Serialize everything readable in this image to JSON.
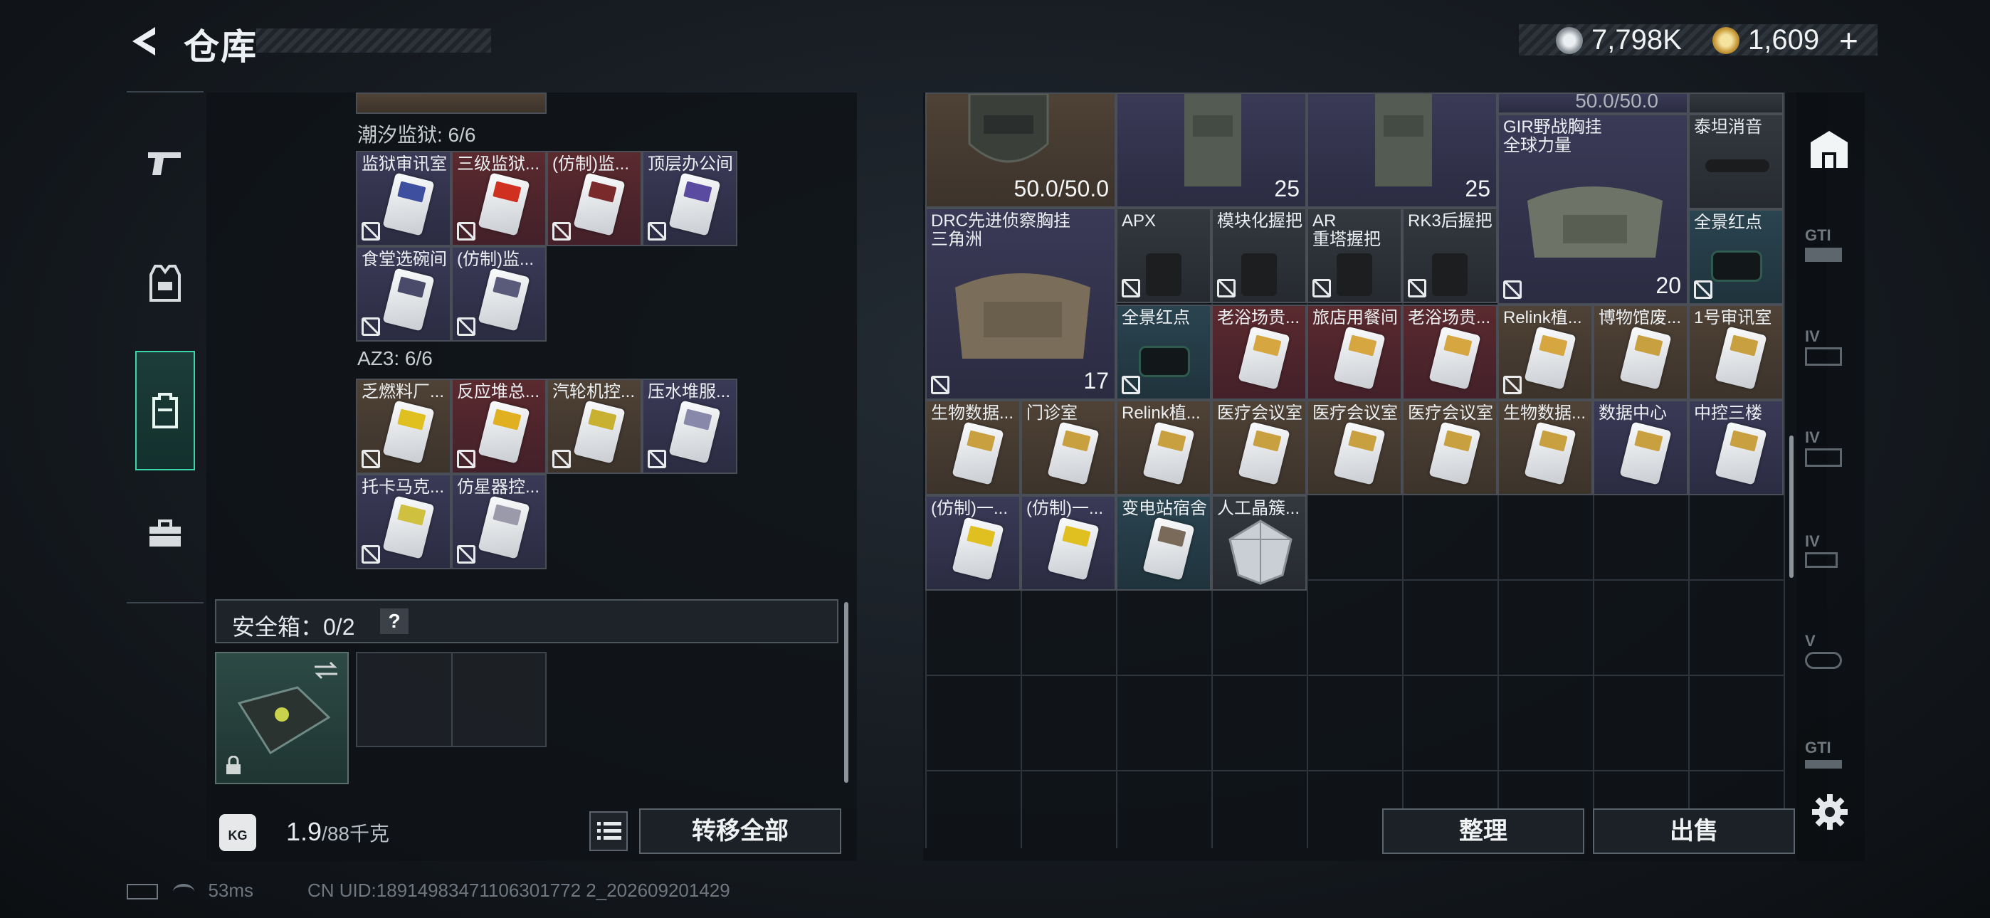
{
  "header": {
    "title": "仓库",
    "currency": [
      {
        "icon": "silver-coin-icon",
        "value": "7,798K"
      },
      {
        "icon": "gold-coin-icon",
        "value": "1,609"
      }
    ],
    "add_label": "+"
  },
  "left_nav": [
    {
      "icon": "pistol-icon"
    },
    {
      "icon": "vest-icon"
    },
    {
      "icon": "backpack-icon",
      "active": true
    },
    {
      "icon": "toolbox-icon"
    }
  ],
  "left_panel": {
    "sections": [
      {
        "title": "潮汐监狱: 6/6",
        "items": [
          {
            "label": "监狱审讯室",
            "bg": "purple",
            "accent": "#3d4f9e"
          },
          {
            "label": "三级监狱...",
            "bg": "red",
            "accent": "#d03020"
          },
          {
            "label": "(仿制)监...",
            "bg": "red",
            "accent": "#7a2a2a"
          },
          {
            "label": "顶层办公间",
            "bg": "purple",
            "accent": "#5a4aa0"
          },
          {
            "label": "食堂选碗间",
            "bg": "purple",
            "accent": "#4a4a6a"
          },
          {
            "label": "(仿制)监...",
            "bg": "purple",
            "accent": "#5a5a7a"
          }
        ]
      },
      {
        "title": "AZ3: 6/6",
        "items": [
          {
            "label": "乏燃料厂...",
            "bg": "brown",
            "accent": "#e0c020"
          },
          {
            "label": "反应堆总...",
            "bg": "red",
            "accent": "#e0b020"
          },
          {
            "label": "汽轮机控...",
            "bg": "brown",
            "accent": "#c8b030"
          },
          {
            "label": "压水堆服...",
            "bg": "purple",
            "accent": "#8888aa"
          },
          {
            "label": "托卡马克...",
            "bg": "purple",
            "accent": "#d0c040"
          },
          {
            "label": "仿星器控...",
            "bg": "purple",
            "accent": "#9a9aaa"
          }
        ]
      }
    ],
    "safe_box": {
      "label": "安全箱：0/2",
      "help": "?"
    },
    "weight": {
      "current": "1.9",
      "capacity": "/88千克"
    },
    "kg_icon": "KG",
    "transfer_label": "转移全部"
  },
  "right_panel": {
    "top_items": [
      {
        "name": "helmet",
        "value": "50.0/50.0"
      },
      {
        "name": "vest-a",
        "value": "25"
      },
      {
        "name": "vest-b",
        "value": "25"
      },
      {
        "name": "gir-header",
        "value": "50.0/50.0"
      }
    ],
    "items": [
      {
        "label": "GIR野战胸挂",
        "sub": "全球力量",
        "value": "20"
      },
      {
        "label": "泰坦消音"
      },
      {
        "label": "DRC先进侦察胸挂",
        "sub": "三角洲",
        "value": "17"
      },
      {
        "label": "APX"
      },
      {
        "label": "模块化握把"
      },
      {
        "label": "AR",
        "sub": "重塔握把"
      },
      {
        "label": "RK3后握把"
      },
      {
        "label": "全景红点"
      },
      {
        "label": "全景红点"
      },
      {
        "label": "老浴场贵..."
      },
      {
        "label": "旅店用餐间"
      },
      {
        "label": "老浴场贵..."
      },
      {
        "label": "Relink植..."
      },
      {
        "label": "博物馆废..."
      },
      {
        "label": "1号审讯室"
      },
      {
        "label": "生物数据..."
      },
      {
        "label": "门诊室"
      },
      {
        "label": "Relink植..."
      },
      {
        "label": "医疗会议室"
      },
      {
        "label": "医疗会议室"
      },
      {
        "label": "医疗会议室"
      },
      {
        "label": "生物数据..."
      },
      {
        "label": "数据中心"
      },
      {
        "label": "中控三楼"
      },
      {
        "label": "(仿制)一..."
      },
      {
        "label": "(仿制)一..."
      },
      {
        "label": "变电站宿舍"
      },
      {
        "label": "人工晶簇..."
      }
    ],
    "sort_label": "整理",
    "sell_label": "出售"
  },
  "right_nav": [
    {
      "icon": "warehouse-icon",
      "active": true
    },
    {
      "icon": "gti-rack-icon",
      "text": "GTI"
    },
    {
      "icon": "storage-iv-icon",
      "text": "IV"
    },
    {
      "icon": "storage-iv2-icon",
      "text": "IV"
    },
    {
      "icon": "storage-iv-add-icon",
      "text": "IV"
    },
    {
      "icon": "storage-v-icon",
      "text": "V"
    },
    {
      "icon": "gti-rack2-icon",
      "text": "GTI"
    },
    {
      "icon": "settings-icon"
    }
  ],
  "status": {
    "ping": "53ms",
    "uid": "CN UID:18914983471106301772 2_202609201429"
  }
}
